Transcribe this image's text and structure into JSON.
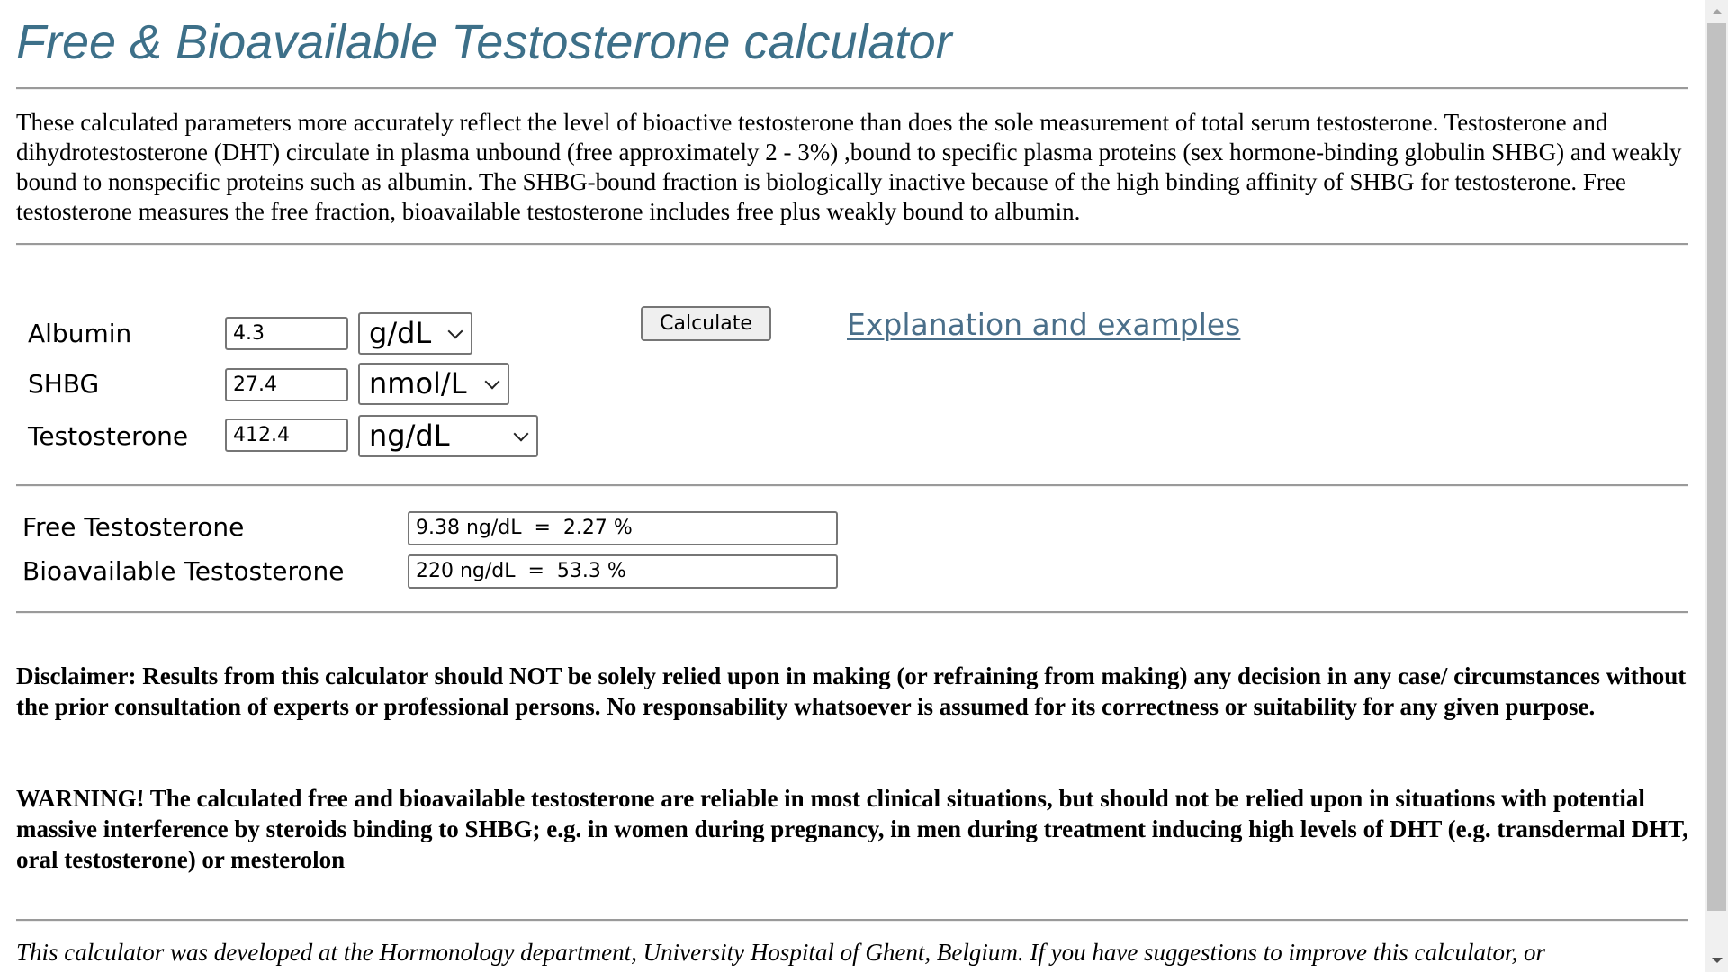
{
  "header": {
    "title": "Free & Bioavailable Testosterone calculator"
  },
  "intro": {
    "text": "These calculated parameters more accurately reflect the level of bioactive testosterone than does the sole measurement of total serum testosterone. Testosterone and dihydrotestosterone (DHT) circulate in plasma unbound (free approximately 2 - 3%) ,bound to specific plasma proteins (sex hormone-binding globulin SHBG) and weakly bound to nonspecific proteins such as albumin. The SHBG-bound fraction is biologically inactive because of the high binding affinity of SHBG for testosterone. Free testosterone measures the free fraction, bioavailable testosterone includes free plus weakly bound to albumin."
  },
  "form": {
    "fields": [
      {
        "label": "Albumin",
        "value": "4.3",
        "unit": "g/dL"
      },
      {
        "label": "SHBG",
        "value": "27.4",
        "unit": "nmol/L"
      },
      {
        "label": "Testosterone",
        "value": "412.4",
        "unit": "ng/dL"
      }
    ],
    "calculate_label": "Calculate",
    "explanation_link": "Explanation and examples"
  },
  "results": [
    {
      "label": "Free Testosterone",
      "value": "9.38 ng/dL  =  2.27 %"
    },
    {
      "label": "Bioavailable Testosterone",
      "value": "220 ng/dL  =  53.3 %"
    }
  ],
  "disclaimer": {
    "text": "Disclaimer: Results from this calculator should NOT be solely relied upon in making (or refraining from making) any decision in any case/ circumstances without the prior consultation of experts or professional persons. No responsability whatsoever is assumed for its correctness or suitability for any given purpose."
  },
  "warning": {
    "text": "WARNING! The calculated free and bioavailable testosterone are reliable in most clinical situations, but should not be relied upon in situations with potential massive interference by steroids binding to SHBG; e.g. in women during pregnancy, in men during treatment inducing high levels of DHT (e.g. transdermal DHT, oral testosterone) or mesterolon"
  },
  "footer": {
    "text": "This calculator was developed at the Hormonology department, University Hospital of Ghent, Belgium. If you have suggestions to improve this calculator, or"
  },
  "colors": {
    "title": "#3d7089",
    "link": "#4a6f8a",
    "rule": "#9a9a9a"
  }
}
